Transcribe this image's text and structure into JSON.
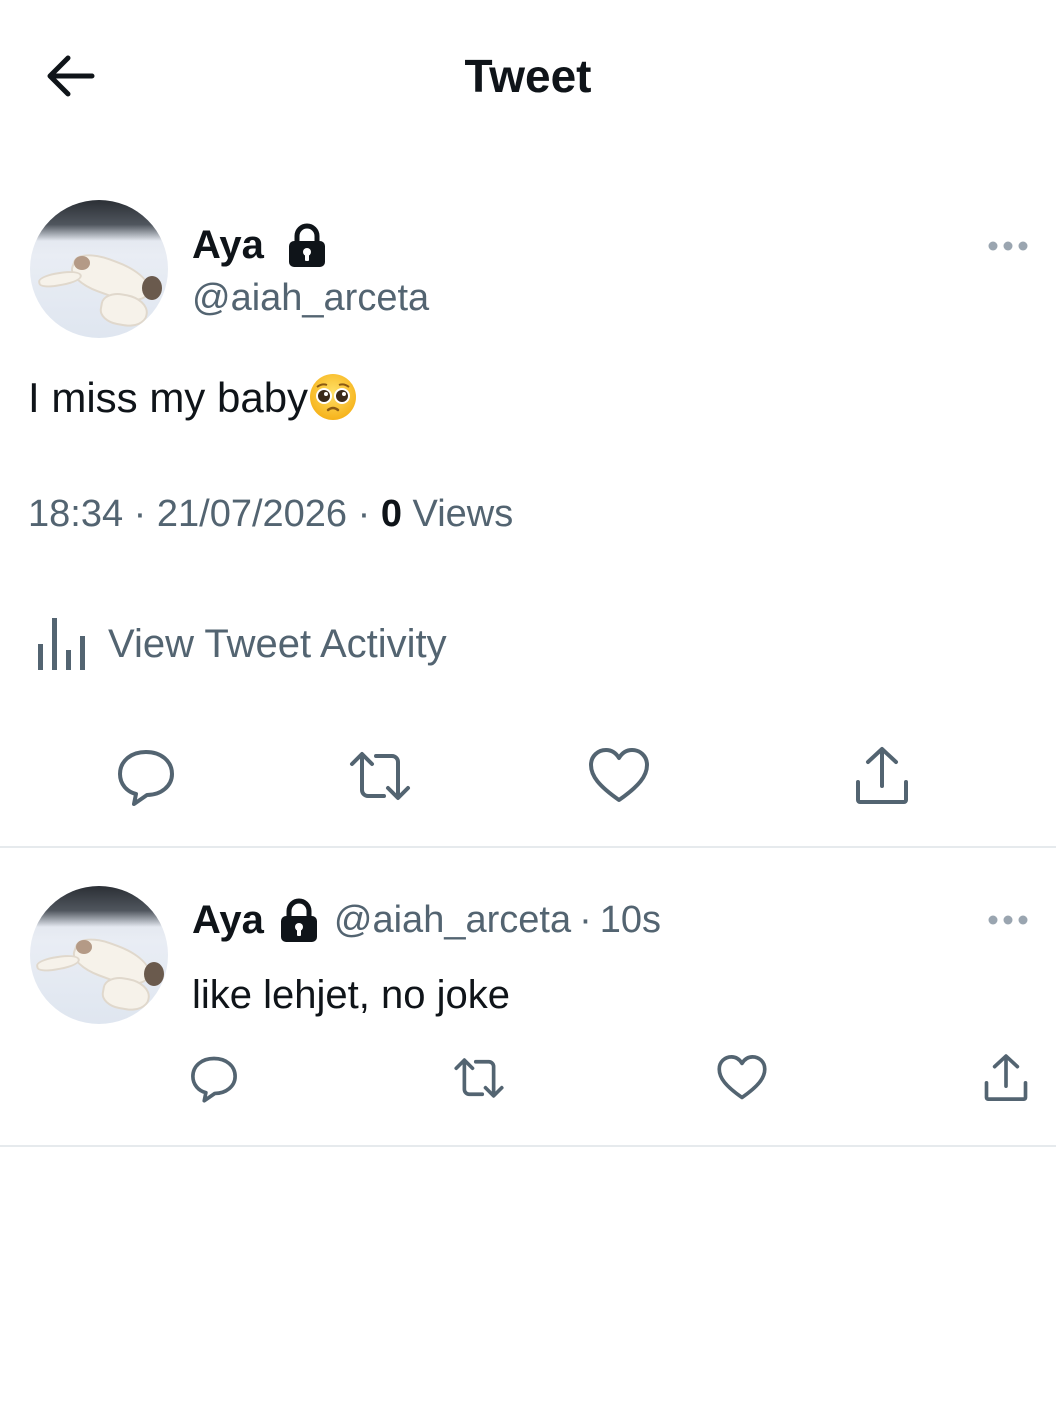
{
  "header": {
    "title": "Tweet",
    "back_icon": "arrow-left-icon"
  },
  "main_tweet": {
    "author_name": "Aya",
    "protected_icon": "lock-icon",
    "handle": "@aiah_arceta",
    "text": "I miss my baby",
    "emoji": "pleading-face-emoji",
    "time": "18:34",
    "date": "21/07/2026",
    "views_count": "0",
    "views_label": "Views",
    "meta_separator": "·",
    "activity_label": "View Tweet Activity",
    "actions": [
      "reply-icon",
      "retweet-icon",
      "like-icon",
      "share-icon"
    ]
  },
  "reply_tweet": {
    "author_name": "Aya",
    "handle": "@aiah_arceta",
    "separator": "·",
    "time_ago": "10s",
    "text": "like lehjet, no joke",
    "actions": [
      "reply-icon",
      "retweet-icon",
      "like-icon",
      "share-icon"
    ]
  },
  "colors": {
    "text_primary": "#0f1419",
    "text_secondary": "#536471",
    "divider": "#e6eaed",
    "background": "#ffffff"
  }
}
